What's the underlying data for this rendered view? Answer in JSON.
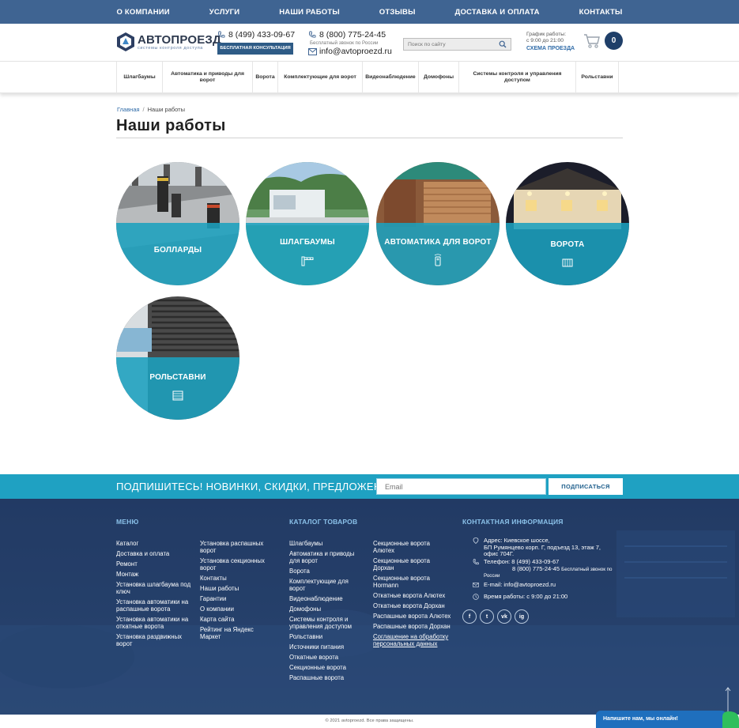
{
  "top_nav": [
    "О КОМПАНИИ",
    "УСЛУГИ",
    "НАШИ РАБОТЫ",
    "ОТЗЫВЫ",
    "ДОСТАВКА И ОПЛАТА",
    "КОНТАКТЫ"
  ],
  "logo": {
    "name": "АВТОПРОЕЗД",
    "tagline": "системы контроля доступа"
  },
  "phone1": {
    "number": "8 (499) 433-09-67",
    "button": "БЕСПЛАТНАЯ КОНСУЛЬТАЦИЯ"
  },
  "phone2": {
    "number": "8 (800) 775-24-45",
    "note": "Бесплатный звонок по России",
    "email": "info@avtoproezd.ru"
  },
  "search": {
    "placeholder": "Поиск по сайту"
  },
  "schedule": {
    "line1": "График работы:",
    "line2": "с 9:00 до 21:00",
    "map_link": "СХЕМА ПРОЕЗДА"
  },
  "cart": {
    "count": "0"
  },
  "categories": [
    "Шлагбаумы",
    "Автоматика и приводы для ворот",
    "Ворота",
    "Комплектующие для ворот",
    "Видеонаблюдение",
    "Домофоны",
    "Системы контроля и управления доступом",
    "Рольставни"
  ],
  "breadcrumb": {
    "home": "Главная",
    "sep": "/",
    "current": "Наши работы"
  },
  "page_title": "Наши работы",
  "works": [
    {
      "label": "БОЛЛАРДЫ"
    },
    {
      "label": "ШЛАГБАУМЫ"
    },
    {
      "label": "АВТОМАТИКА ДЛЯ ВОРОТ"
    },
    {
      "label": "ВОРОТА"
    },
    {
      "label": "РОЛЬСТАВНИ"
    }
  ],
  "subscribe": {
    "title": "ПОДПИШИТЕСЬ! НОВИНКИ, СКИДКИ, ПРЕДЛОЖЕНИЯ!",
    "placeholder": "Email",
    "button": "ПОДПИСАТЬСЯ"
  },
  "footer": {
    "menu_title": "МЕНЮ",
    "menu_col1": [
      "Каталог",
      "Доставка и оплата",
      "Ремонт",
      "Монтаж",
      "Установка шлагбаума под ключ",
      "Установка автоматики на распашные ворота",
      "Установка автоматики на откатные ворота",
      "Установка раздвижных ворот"
    ],
    "menu_col2": [
      "Установка распашных ворот",
      "Установка секционных ворот",
      "Контакты",
      "Наши работы",
      "Гарантии",
      "О компании",
      "Карта сайта",
      "Рейтинг на Яндекс Маркет"
    ],
    "catalog_title": "КАТАЛОГ ТОВАРОВ",
    "catalog_col1": [
      "Шлагбаумы",
      "Автоматика и приводы для ворот",
      "Ворота",
      "Комплектующие для ворот",
      "Видеонаблюдение",
      "Домофоны",
      "Системы контроля и управления доступом",
      "Рольставни",
      "Источники питания",
      "Откатные ворота",
      "Секционные ворота",
      "Распашные ворота"
    ],
    "catalog_col2": [
      "Секционные ворота Алютех",
      "Секционные ворота Дорхан",
      "Секционные ворота Hormann",
      "Откатные ворота Алютех",
      "Откатные ворота Дорхан",
      "Распашные ворота Алютех",
      "Распашные ворота Дорхан",
      "Соглашение на обработку персональных данных"
    ],
    "contact_title": "КОНТАКТНАЯ ИНФОРМАЦИЯ",
    "address_label": "Адрес: Киевское шоссе,",
    "address_line2": "БП Румянцево корп. Г, подъезд 13, этаж 7,",
    "address_line3": "офис 704Г.",
    "phone_label": "Телефон: 8 (499) 433-09-67",
    "phone_line2": "8 (800) 775-24-45",
    "phone_note": "Бесплатный звонок по",
    "phone_note2": "России",
    "email": "E-mail: info@avtoproezd.ru",
    "hours": "Время работы: с 9:00 до 21:00",
    "socials": [
      "f",
      "t",
      "vk",
      "ig"
    ]
  },
  "copyright": "© 2021 avtoproezd. Все права защищены.",
  "chat": "Напишите нам, мы онлайн!",
  "colors": {
    "nav": "#3f6492",
    "accent": "#1fa1c2",
    "footer": "#1e3762",
    "brand_dark": "#1f3f69"
  }
}
